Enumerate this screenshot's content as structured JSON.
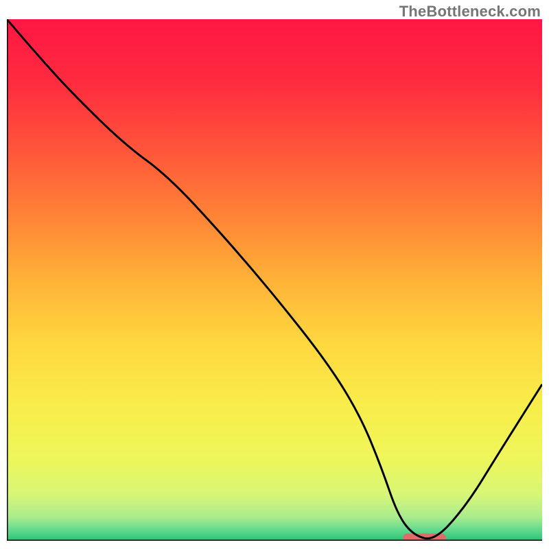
{
  "watermark": "TheBottleneck.com",
  "colors": {
    "gradient_stops": [
      {
        "offset": 0.0,
        "color": "#ff1744"
      },
      {
        "offset": 0.12,
        "color": "#ff2b3f"
      },
      {
        "offset": 0.25,
        "color": "#ff553a"
      },
      {
        "offset": 0.38,
        "color": "#ff8436"
      },
      {
        "offset": 0.5,
        "color": "#ffb238"
      },
      {
        "offset": 0.62,
        "color": "#ffd73e"
      },
      {
        "offset": 0.74,
        "color": "#f8ed4a"
      },
      {
        "offset": 0.84,
        "color": "#eef65a"
      },
      {
        "offset": 0.91,
        "color": "#d8f676"
      },
      {
        "offset": 0.955,
        "color": "#a9ec8e"
      },
      {
        "offset": 0.98,
        "color": "#5fd98e"
      },
      {
        "offset": 1.0,
        "color": "#2bc275"
      }
    ],
    "curve_stroke": "#000000",
    "axis_stroke": "#000000",
    "sweet_spot": "#e26a6a"
  },
  "chart_data": {
    "type": "line",
    "title": "",
    "xlabel": "",
    "ylabel": "",
    "xlim": [
      0,
      100
    ],
    "ylim": [
      0,
      100
    ],
    "x": [
      0,
      5,
      12,
      22,
      30,
      40,
      50,
      60,
      66,
      70,
      73,
      76,
      80,
      86,
      92,
      100
    ],
    "values": [
      100,
      94,
      86,
      76,
      70,
      59,
      47,
      34,
      24,
      14,
      5,
      1,
      0,
      7,
      17,
      30
    ],
    "sweet_spot": {
      "x_start": 74,
      "x_end": 82,
      "y": 0.6
    }
  }
}
